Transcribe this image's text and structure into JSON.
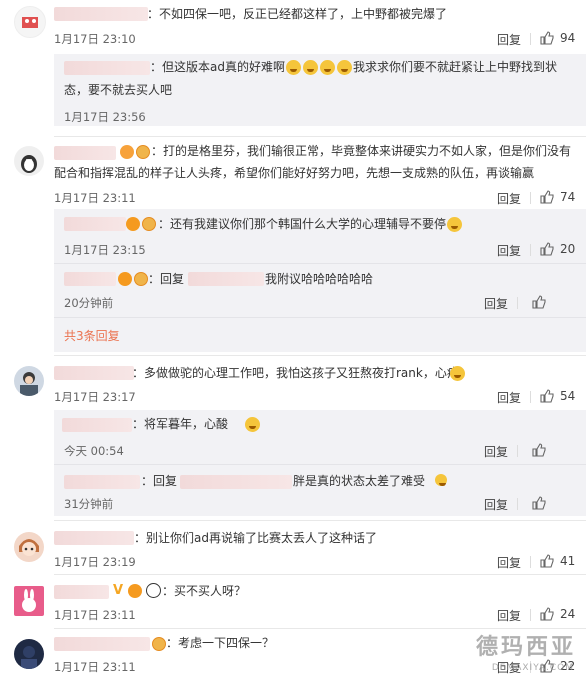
{
  "comments": [
    {
      "text": "：不如四保一吧，反正已经都这样了，上中野都被完爆了",
      "time": "1月17日 23:10",
      "reply_label": "回复",
      "likes": "94"
    },
    {
      "text": "：打的是格里芬，我们输很正常，毕竟整体来讲硬实力不如人家，但是你们没有",
      "text2": "配合和指挥混乱的样子让人头疼，希望你们能好好努力吧，先想一支成熟的队伍，再谈输赢",
      "time": "1月17日 23:11",
      "reply_label": "回复",
      "likes": "74"
    },
    {
      "text": "：多做做驼的心理工作吧，我怕这孩子又狂熬夜打rank，心疼",
      "time": "1月17日 23:17",
      "reply_label": "回复",
      "likes": "54"
    },
    {
      "text": "：别让你们ad再说输了比赛太丢人了这种话了",
      "time": "1月17日 23:19",
      "reply_label": "回复",
      "likes": "41"
    },
    {
      "text": "：买不买人呀？",
      "time": "1月17日 23:11",
      "reply_label": "回复",
      "likes": "24"
    },
    {
      "text": "：考虑一下四保一？",
      "time": "1月17日 23:11",
      "reply_label": "回复",
      "likes": "22"
    }
  ],
  "replies": [
    {
      "text": "：但这版本ad真的好难啊",
      "text_b": "我求求你们要不就赶紧让上中野找到状",
      "text2": "态，要不就去买人吧",
      "time": "1月17日 23:56"
    },
    {
      "text": "：还有我建议你们那个韩国什么大学的心理辅导不要停",
      "time": "1月17日 23:15",
      "likes": "20"
    },
    {
      "text_a": "：回复",
      "text_b": "我附议哈哈哈哈哈哈",
      "time": "20分钟前"
    },
    {
      "text": "：将军暮年，心酸",
      "time": "今天 00:54"
    },
    {
      "text_a": "：回复",
      "text_b": "胖是真的状态太差了难受",
      "time": "31分钟前"
    }
  ],
  "more_replies": "共3条回复",
  "reply_label": "回复",
  "watermark": "德玛西亚",
  "watermark_sub": "DEMAXIYA.COM"
}
